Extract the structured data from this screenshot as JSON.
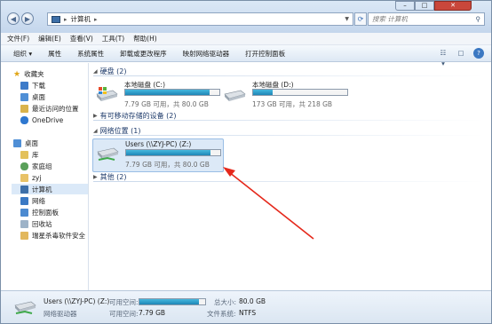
{
  "address": {
    "crumb": "计算机",
    "search_placeholder": "搜索 计算机"
  },
  "menu": [
    "文件(F)",
    "编辑(E)",
    "查看(V)",
    "工具(T)",
    "帮助(H)"
  ],
  "toolbar": [
    "组织 ▾",
    "属性",
    "系统属性",
    "卸载或更改程序",
    "映射网络驱动器",
    "打开控制面板"
  ],
  "nav": {
    "favorites": "收藏夹",
    "fav_items": [
      "下载",
      "桌面",
      "最近访问的位置",
      "OneDrive"
    ],
    "desktop": "桌面",
    "desk_items": [
      "库",
      "家庭组",
      "zyj",
      "计算机",
      "网络",
      "控制面板",
      "回收站",
      "瑞星杀毒软件安全"
    ]
  },
  "groups": {
    "hdd": "硬盘 (2)",
    "removable": "有可移动存储的设备 (2)",
    "network": "网络位置 (1)",
    "other": "其他 (2)"
  },
  "drives": {
    "c": {
      "name": "本地磁盘 (C:)",
      "size": "7.79 GB 可用，共 80.0 GB",
      "used_fraction": 0.9
    },
    "d": {
      "name": "本地磁盘 (D:)",
      "size": "173 GB 可用，共 218 GB",
      "used_fraction": 0.21
    },
    "z": {
      "name": "Users (\\\\ZYJ-PC) (Z:)",
      "size": "7.79 GB 可用，共 80.0 GB",
      "used_fraction": 0.9
    }
  },
  "status": {
    "name": "Users (\\\\ZYJ-PC) (Z:)",
    "type": "网络驱动器",
    "free_label": "可用空间:",
    "free_value": "7.79 GB",
    "total_label": "总大小:",
    "total_value": "80.0 GB",
    "fs_label": "文件系统:",
    "fs_value": "NTFS",
    "used_fraction": 0.9
  },
  "colors": {
    "accent": "#1e86b6",
    "arrow": "#e5281b",
    "selection": "#dce9f7"
  }
}
